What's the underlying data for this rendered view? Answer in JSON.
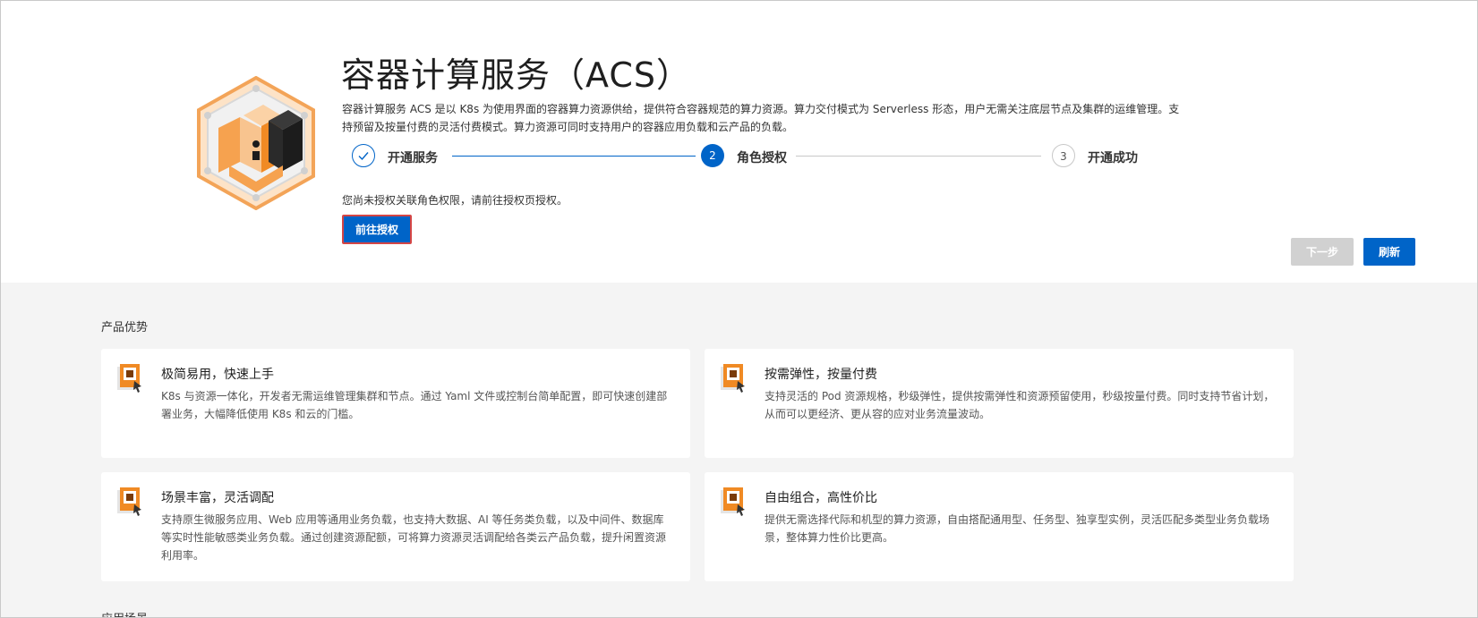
{
  "header": {
    "title": "容器计算服务（ACS）",
    "description": "容器计算服务 ACS 是以 K8s 为使用界面的容器算力资源供给，提供符合容器规范的算力资源。算力交付模式为 Serverless 形态，用户无需关注底层节点及集群的运维管理。支持预留及按量付费的灵活付费模式。算力资源可同时支持用户的容器应用负载和云产品的负载。"
  },
  "steps": [
    {
      "number": "",
      "label": "开通服务",
      "state": "done"
    },
    {
      "number": "2",
      "label": "角色授权",
      "state": "active"
    },
    {
      "number": "3",
      "label": "开通成功",
      "state": "wait"
    }
  ],
  "notice": "您尚未授权关联角色权限，请前往授权页授权。",
  "buttons": {
    "go_auth": "前往授权",
    "next": "下一步",
    "refresh": "刷新"
  },
  "advantages": {
    "title": "产品优势",
    "cards": [
      {
        "title": "极简易用，快速上手",
        "desc": "K8s 与资源一体化，开发者无需运维管理集群和节点。通过 Yaml 文件或控制台简单配置，即可快速创建部署业务，大幅降低使用 K8s 和云的门槛。"
      },
      {
        "title": "按需弹性，按量付费",
        "desc": "支持灵活的 Pod 资源规格，秒级弹性，提供按需弹性和资源预留使用，秒级按量付费。同时支持节省计划，从而可以更经济、更从容的应对业务流量波动。"
      },
      {
        "title": "场景丰富，灵活调配",
        "desc": "支持原生微服务应用、Web 应用等通用业务负载，也支持大数据、AI 等任务类负载，以及中间件、数据库等实时性能敏感类业务负载。通过创建资源配额，可将算力资源灵活调配给各类云产品负载，提升闲置资源利用率。"
      },
      {
        "title": "自由组合，高性价比",
        "desc": "提供无需选择代际和机型的算力资源，自由搭配通用型、任务型、独享型实例，灵活匹配多类型业务负载场景，整体算力性价比更高。"
      }
    ]
  },
  "next_section_title": "应用场景",
  "colors": {
    "primary": "#0064c8",
    "highlight_border": "#d54545",
    "disabled": "#d1d1d1",
    "icon_orange": "#f08a24"
  }
}
